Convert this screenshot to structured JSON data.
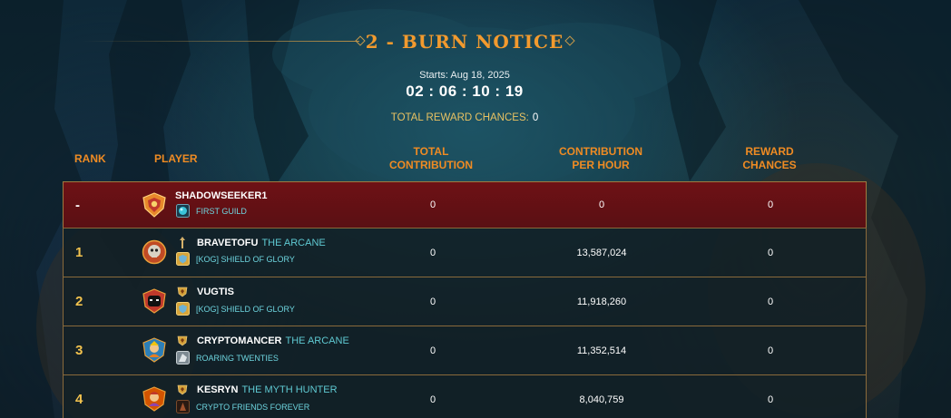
{
  "colors": {
    "accent_orange": "#f29a2e",
    "accent_gold": "#e8c262",
    "highlight_row": "#6e1115",
    "title_tag": "#5fc9d2",
    "guild_text": "#6ed5df"
  },
  "event": {
    "title": "2 - BURN NOTICE",
    "starts": "Starts: Aug 18, 2025",
    "countdown": "02 : 06 : 10 : 19",
    "total_reward_label": "TOTAL REWARD CHANCES:",
    "total_reward_value": "0"
  },
  "columns": {
    "rank": "RANK",
    "player": "PLAYER",
    "total_line1": "TOTAL",
    "total_line2": "CONTRIBUTION",
    "cph_line1": "CONTRIBUTION",
    "cph_line2": "PER HOUR",
    "reward_line1": "REWARD",
    "reward_line2": "CHANCES"
  },
  "rows": [
    {
      "rank": "-",
      "player": "SHADOWSEEKER1",
      "player_title": "",
      "guild": "FIRST GUILD",
      "total": "0",
      "per_hour": "0",
      "reward": "0",
      "avatar_icon": "shield-crest-avatar-icon",
      "guild_icon": "blue-orb-guild-icon"
    },
    {
      "rank": "1",
      "player": "BRAVETOFU",
      "player_title": "THE ARCANE",
      "guild": "[KOG] SHIELD OF GLORY",
      "total": "0",
      "per_hour": "13,587,024",
      "reward": "0",
      "avatar_icon": "skull-avatar-icon",
      "guild_icon": "shield-guild-icon"
    },
    {
      "rank": "2",
      "player": "VUGTIS",
      "player_title": "",
      "guild": "[KOG] SHIELD OF GLORY",
      "total": "0",
      "per_hour": "11,918,260",
      "reward": "0",
      "avatar_icon": "mask-avatar-icon",
      "guild_icon": "shield-guild-icon"
    },
    {
      "rank": "3",
      "player": "CRYPTOMANCER",
      "player_title": "THE ARCANE",
      "guild": "ROARING TWENTIES",
      "total": "0",
      "per_hour": "11,352,514",
      "reward": "0",
      "avatar_icon": "character-avatar-icon",
      "guild_icon": "wolf-guild-icon"
    },
    {
      "rank": "4",
      "player": "KESRYN",
      "player_title": "THE MYTH HUNTER",
      "guild": "CRYPTO FRIENDS FOREVER",
      "total": "0",
      "per_hour": "8,040,759",
      "reward": "0",
      "avatar_icon": "character-avatar-icon",
      "guild_icon": "dark-guild-icon"
    }
  ]
}
